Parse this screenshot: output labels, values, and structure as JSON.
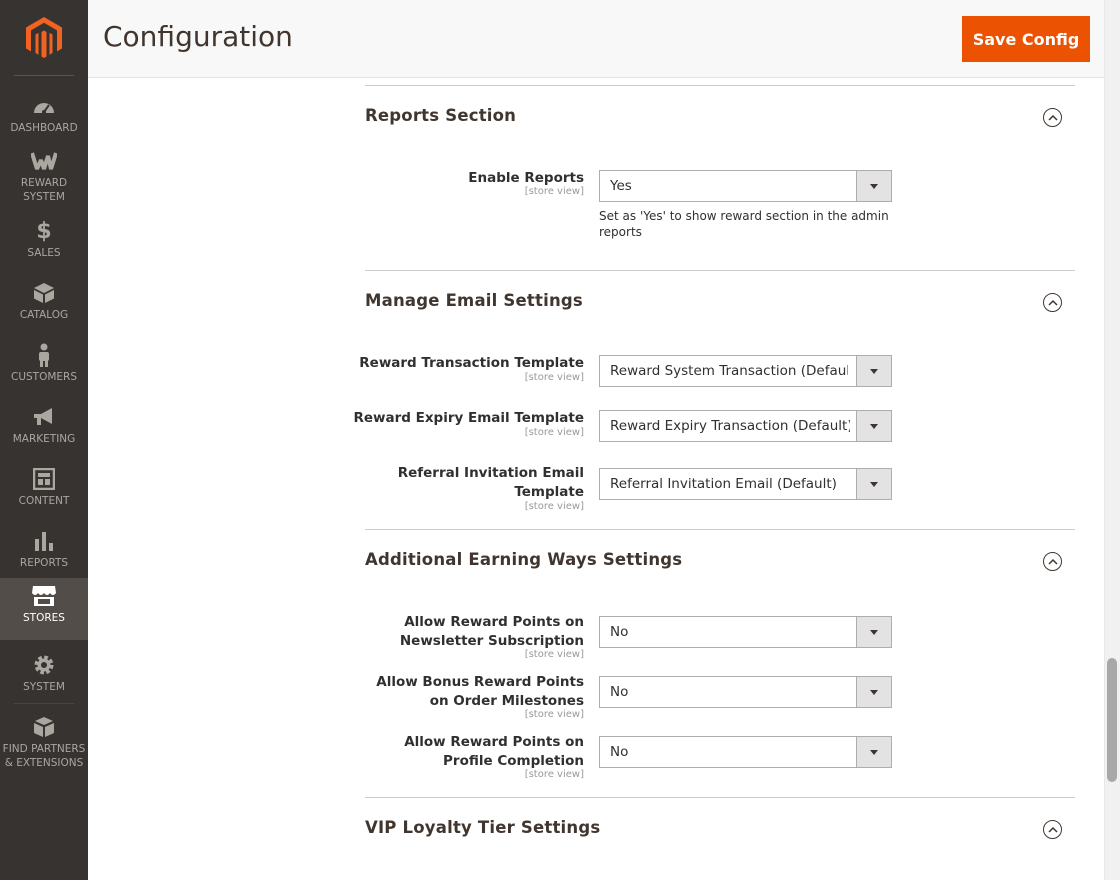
{
  "header": {
    "title": "Configuration",
    "save_label": "Save Config"
  },
  "sidebar": {
    "items": [
      {
        "label": "DASHBOARD",
        "icon": "dashboard-icon"
      },
      {
        "label": "REWARD SYSTEM",
        "icon": "reward-system-icon"
      },
      {
        "label": "SALES",
        "icon": "dollar-icon"
      },
      {
        "label": "CATALOG",
        "icon": "box-icon"
      },
      {
        "label": "CUSTOMERS",
        "icon": "person-icon"
      },
      {
        "label": "MARKETING",
        "icon": "megaphone-icon"
      },
      {
        "label": "CONTENT",
        "icon": "layout-icon"
      },
      {
        "label": "REPORTS",
        "icon": "bar-chart-icon"
      },
      {
        "label": "STORES",
        "icon": "storefront-icon",
        "active": true
      },
      {
        "label": "SYSTEM",
        "icon": "gear-icon"
      },
      {
        "label": "FIND PARTNERS & EXTENSIONS",
        "icon": "cubes-icon"
      }
    ]
  },
  "sections": {
    "reports": {
      "title": "Reports Section",
      "enable_reports": {
        "label": "Enable Reports",
        "scope": "[store view]",
        "value": "Yes",
        "note": "Set as 'Yes' to show reward section in the admin reports"
      }
    },
    "email": {
      "title": "Manage Email Settings",
      "transaction": {
        "label": "Reward Transaction Template",
        "scope": "[store view]",
        "value": "Reward System Transaction (Default)"
      },
      "expiry": {
        "label": "Reward Expiry Email Template",
        "scope": "[store view]",
        "value": "Reward Expiry Transaction (Default)"
      },
      "referral": {
        "label": "Referral Invitation Email Template",
        "scope": "[store view]",
        "value": "Referral Invitation Email (Default)"
      }
    },
    "earning": {
      "title": "Additional Earning Ways Settings",
      "newsletter": {
        "label": "Allow Reward Points on Newsletter Subscription",
        "scope": "[store view]",
        "value": "No"
      },
      "milestones": {
        "label": "Allow Bonus Reward Points on Order Milestones",
        "scope": "[store view]",
        "value": "No"
      },
      "profile": {
        "label": "Allow Reward Points on Profile Completion",
        "scope": "[store view]",
        "value": "No"
      }
    },
    "vip": {
      "title": "VIP Loyalty Tier Settings"
    }
  },
  "colors": {
    "accent": "#eb5202",
    "sidebar_bg": "#373330",
    "sidebar_active": "#524d49"
  }
}
